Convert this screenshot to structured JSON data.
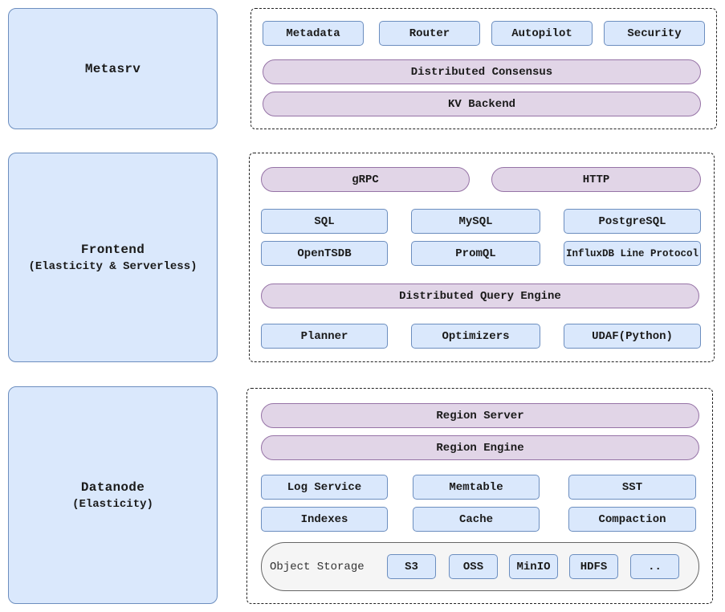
{
  "colors": {
    "component_fill": "#dae8fc",
    "component_stroke": "#6c8ebf",
    "layer_fill": "#e1d5e7",
    "layer_stroke": "#9673a6",
    "storage_fill": "#f5f5f5"
  },
  "metasrv": {
    "title": "Metasrv",
    "components": [
      "Metadata",
      "Router",
      "Autopilot",
      "Security"
    ],
    "layers": [
      "Distributed Consensus",
      "KV Backend"
    ]
  },
  "frontend": {
    "title": "Frontend",
    "subtitle": "(Elasticity & Serverless)",
    "protocols": [
      "gRPC",
      "HTTP"
    ],
    "apis": [
      "SQL",
      "MySQL",
      "PostgreSQL",
      "OpenTSDB",
      "PromQL",
      "InfluxDB Line Protocol"
    ],
    "engine": "Distributed Query Engine",
    "engine_components": [
      "Planner",
      "Optimizers",
      "UDAF(Python)"
    ]
  },
  "datanode": {
    "title": "Datanode",
    "subtitle": "(Elasticity)",
    "layers": [
      "Region Server",
      "Region Engine"
    ],
    "components": [
      "Log Service",
      "Memtable",
      "SST",
      "Indexes",
      "Cache",
      "Compaction"
    ],
    "object_storage": {
      "label": "Object Storage",
      "backends": [
        "S3",
        "OSS",
        "MinIO",
        "HDFS",
        ".."
      ]
    }
  }
}
